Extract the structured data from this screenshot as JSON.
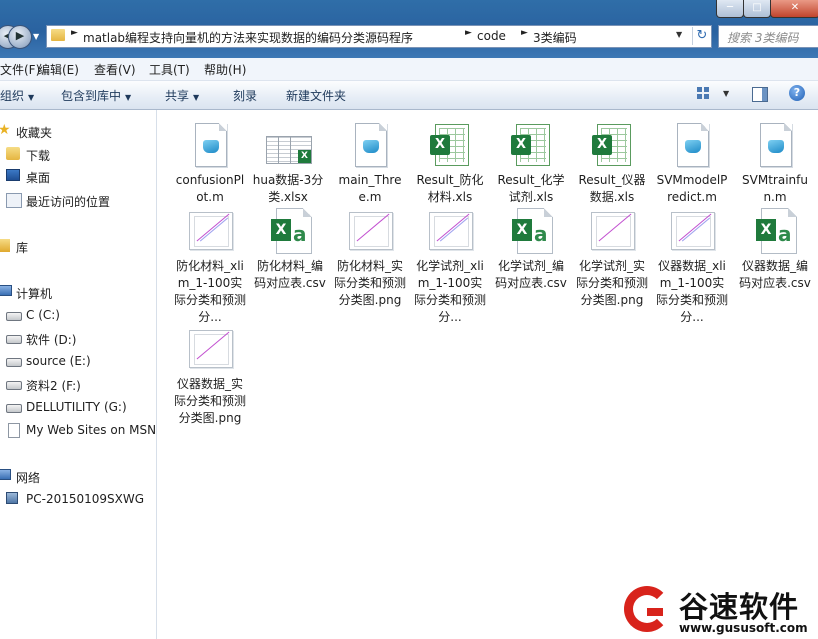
{
  "window": {
    "title": "3类编码",
    "controls": {
      "minimize": "─",
      "maximize": "□",
      "close": "✕"
    }
  },
  "address_bar": {
    "crumbs": [
      "matlab编程支持向量机的方法来实现数据的编码分类源码程序",
      "code",
      "3类编码"
    ],
    "separator": "►"
  },
  "search": {
    "placeholder": "搜索 3类编码"
  },
  "menu": [
    "文件(F)",
    "编辑(E)",
    "查看(V)",
    "工具(T)",
    "帮助(H)"
  ],
  "commands": [
    "组织",
    "包含到库中",
    "共享",
    "刻录",
    "新建文件夹"
  ],
  "nav": {
    "favorites": {
      "label": "收藏夹",
      "items": [
        "下载",
        "桌面",
        "最近访问的位置"
      ]
    },
    "libraries": {
      "label": "库"
    },
    "computer": {
      "label": "计算机",
      "items": [
        "C (C:)",
        "软件 (D:)",
        "source (E:)",
        "资料2 (F:)",
        "DELLUTILITY (G:)",
        "My Web Sites on MSN"
      ]
    },
    "network": {
      "label": "网络",
      "items": [
        "PC-20150109SXWG"
      ]
    }
  },
  "files": [
    {
      "name": "confusionPlot.m",
      "type": "matlab"
    },
    {
      "name": "hua数据-3分类.xlsx",
      "type": "xlsx"
    },
    {
      "name": "main_Three.m",
      "type": "matlab"
    },
    {
      "name": "Result_防化材料.xls",
      "type": "xls"
    },
    {
      "name": "Result_化学试剂.xls",
      "type": "xls"
    },
    {
      "name": "Result_仪器数据.xls",
      "type": "xls"
    },
    {
      "name": "SVMmodelPredict.m",
      "type": "matlab"
    },
    {
      "name": "SVMtrainfun.m",
      "type": "matlab"
    },
    {
      "name": "防化材料_xlim_1-100实际分类和预测分...",
      "type": "png"
    },
    {
      "name": "防化材料_编码对应表.csv",
      "type": "csv"
    },
    {
      "name": "防化材料_实际分类和预测分类图.png",
      "type": "png"
    },
    {
      "name": "化学试剂_xlim_1-100实际分类和预测分...",
      "type": "png"
    },
    {
      "name": "化学试剂_编码对应表.csv",
      "type": "csv"
    },
    {
      "name": "化学试剂_实际分类和预测分类图.png",
      "type": "png"
    },
    {
      "name": "仪器数据_xlim_1-100实际分类和预测分...",
      "type": "png"
    },
    {
      "name": "仪器数据_编码对应表.csv",
      "type": "csv"
    },
    {
      "name": "仪器数据_实际分类和预测分类图.png",
      "type": "png"
    }
  ],
  "watermark": {
    "title": "谷速软件",
    "url": "www.gususoft.com"
  },
  "colors": {
    "accent": "#2a62a0",
    "excel_green": "#1f7a3c",
    "watermark_red": "#d8231b"
  }
}
